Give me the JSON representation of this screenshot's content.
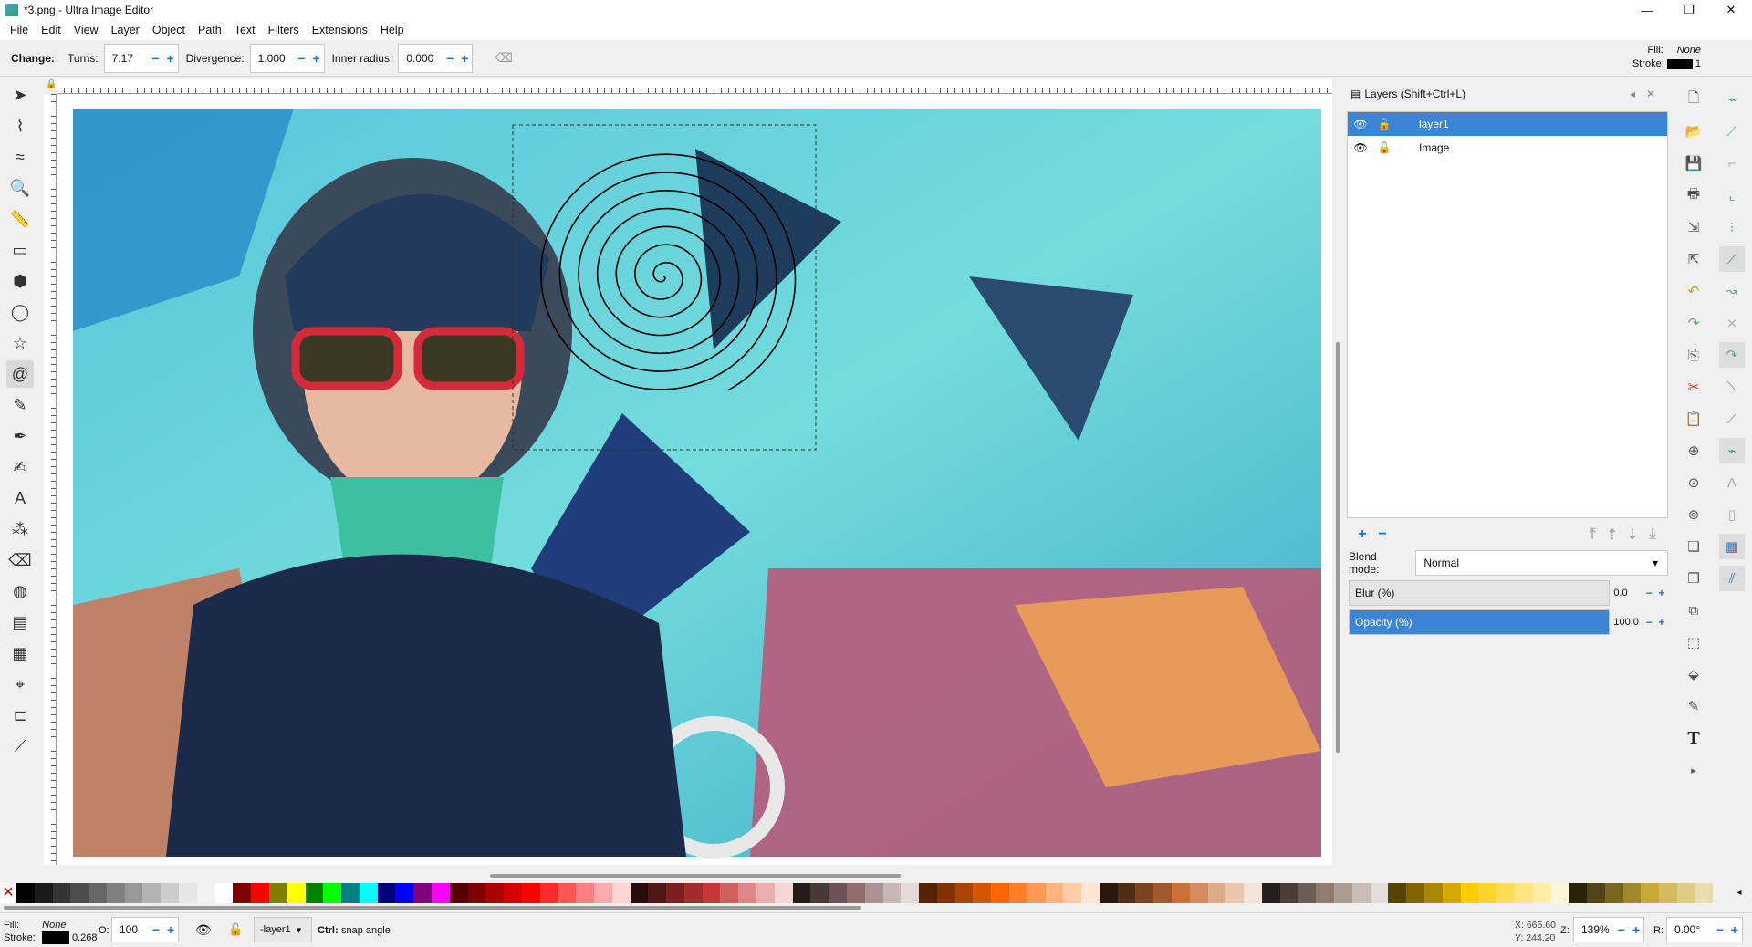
{
  "window": {
    "title": "*3.png - Ultra Image Editor",
    "controls": [
      "—",
      "❐",
      "✕"
    ]
  },
  "menu": [
    "File",
    "Edit",
    "View",
    "Layer",
    "Object",
    "Path",
    "Text",
    "Filters",
    "Extensions",
    "Help"
  ],
  "controls": {
    "change_label": "Change:",
    "turns_label": "Turns:",
    "turns_value": "7.17",
    "divergence_label": "Divergence:",
    "divergence_value": "1.000",
    "inner_label": "Inner radius:",
    "inner_value": "0.000"
  },
  "style_indicator": {
    "fill_label": "Fill:",
    "fill_value": "None",
    "stroke_label": "Stroke:",
    "stroke_width": "1"
  },
  "tools": [
    {
      "name": "selector-tool",
      "glyph": "➤"
    },
    {
      "name": "node-tool",
      "glyph": "⌇"
    },
    {
      "name": "tweak-tool",
      "glyph": "≈"
    },
    {
      "name": "zoom-tool",
      "glyph": "🔍"
    },
    {
      "name": "measure-tool",
      "glyph": "📏"
    },
    {
      "name": "rectangle-tool",
      "glyph": "▭"
    },
    {
      "name": "box3d-tool",
      "glyph": "⬢"
    },
    {
      "name": "ellipse-tool",
      "glyph": "◯"
    },
    {
      "name": "star-tool",
      "glyph": "☆"
    },
    {
      "name": "spiral-tool",
      "glyph": "@"
    },
    {
      "name": "pencil-tool",
      "glyph": "✎"
    },
    {
      "name": "pen-tool",
      "glyph": "✒"
    },
    {
      "name": "calligraphy-tool",
      "glyph": "✍"
    },
    {
      "name": "text-tool",
      "glyph": "A"
    },
    {
      "name": "spray-tool",
      "glyph": "⁂"
    },
    {
      "name": "eraser-tool",
      "glyph": "⌫"
    },
    {
      "name": "bucket-tool",
      "glyph": "◍"
    },
    {
      "name": "gradient-tool",
      "glyph": "▤"
    },
    {
      "name": "mesh-tool",
      "glyph": "▦"
    },
    {
      "name": "dropper-tool",
      "glyph": "⌖"
    },
    {
      "name": "connector-tool",
      "glyph": "⊏"
    },
    {
      "name": "lpe-tool",
      "glyph": "⟋"
    }
  ],
  "layers_panel": {
    "title": "Layers (Shift+Ctrl+L)",
    "layers": [
      {
        "name": "layer1",
        "selected": true
      },
      {
        "name": "Image",
        "selected": false
      }
    ],
    "blend_label": "Blend mode:",
    "blend_value": "Normal",
    "blur_label": "Blur (%)",
    "blur_value": "0.0",
    "opacity_label": "Opacity (%)",
    "opacity_value": "100.0"
  },
  "palette": [
    "#000000",
    "#1a1a1a",
    "#333333",
    "#4d4d4d",
    "#666666",
    "#808080",
    "#999999",
    "#b3b3b3",
    "#cccccc",
    "#e6e6e6",
    "#f2f2f2",
    "#ffffff",
    "#800000",
    "#ff0000",
    "#808000",
    "#ffff00",
    "#008000",
    "#00ff00",
    "#008080",
    "#00ffff",
    "#000080",
    "#0000ff",
    "#800080",
    "#ff00ff",
    "#550000",
    "#800000",
    "#aa0000",
    "#d40000",
    "#ff0000",
    "#ff2a2a",
    "#ff5555",
    "#ff8080",
    "#ffaaaa",
    "#ffd5d5",
    "#280b0b",
    "#501616",
    "#782121",
    "#a02c2c",
    "#c83737",
    "#d35f5f",
    "#de8787",
    "#e9afaf",
    "#f4d7d7",
    "#241c1c",
    "#483737",
    "#6c5353",
    "#916f6f",
    "#ac9393",
    "#c8b7b7",
    "#e3dbdb",
    "#552200",
    "#803300",
    "#aa4400",
    "#d45500",
    "#ff6600",
    "#ff7f2a",
    "#ff9955",
    "#ffb380",
    "#ffccaa",
    "#ffe6d5",
    "#28170b",
    "#502d16",
    "#784421",
    "#a05a2c",
    "#c87137",
    "#d38d5f",
    "#deaa87",
    "#e9c6af",
    "#f4e3d7",
    "#241f1c",
    "#483e37",
    "#6c5d53",
    "#917c6f",
    "#ac9d93",
    "#c8beb7",
    "#e3dedb",
    "#554400",
    "#806600",
    "#aa8800",
    "#d4aa00",
    "#ffcc00",
    "#ffd42a",
    "#ffdd55",
    "#ffe680",
    "#ffeeaa",
    "#fff6d5",
    "#28220b",
    "#504416",
    "#786721",
    "#a0892c",
    "#c8ab37",
    "#d3bc5f",
    "#decd87",
    "#e9ddaf"
  ],
  "status": {
    "fill_label": "Fill:",
    "fill_value": "None",
    "stroke_label": "Stroke:",
    "stroke_value": "0.268",
    "opacity_label": "O:",
    "opacity_value": "100",
    "layer_value": "-layer1",
    "hint_bold": "Ctrl:",
    "hint_text": "snap angle",
    "x_label": "X:",
    "x_value": "665.60",
    "y_label": "Y:",
    "y_value": "244.20",
    "zoom_label": "Z:",
    "zoom_value": "139%",
    "rotate_label": "R:",
    "rotate_value": "0.00°"
  }
}
